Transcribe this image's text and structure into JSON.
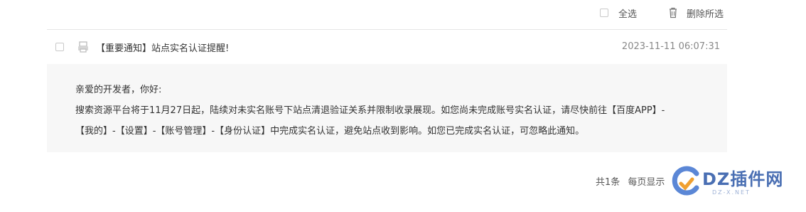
{
  "toolbar": {
    "select_all_label": "全选",
    "delete_selected_label": "删除所选"
  },
  "message": {
    "title": "【重要通知】站点实名认证提醒!",
    "time": "2023-11-11 06:07:31",
    "greeting": "亲爱的开发者，你好:",
    "line1": "搜索资源平台将于11月27日起，陆续对未实名账号下站点清退验证关系并限制收录展现。如您尚未完成账号实名认证，请尽快前往【百度APP】-",
    "line2": "【我的】-【设置】-【账号管理】-【身份认证】中完成实名认证，避免站点收到影响。如您已完成实名认证，可忽略此通知。"
  },
  "pagination": {
    "total": "共1条",
    "per_page": "每页显示"
  },
  "watermark": {
    "brand": "DZ插件网",
    "sub": "DZ-X.NET"
  }
}
